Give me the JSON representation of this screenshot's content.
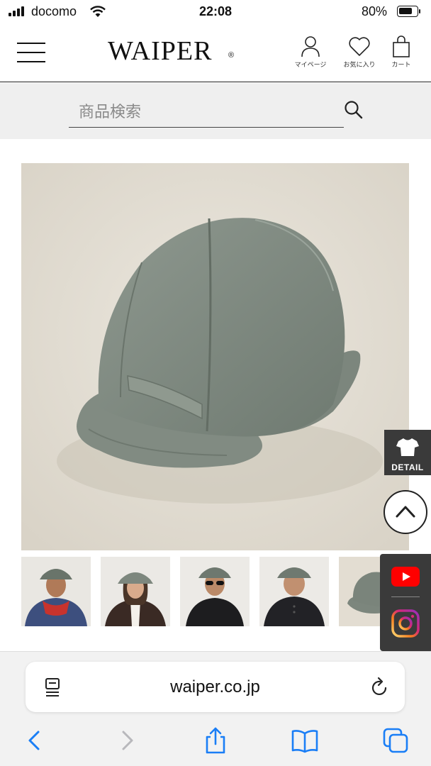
{
  "status_bar": {
    "carrier": "docomo",
    "time": "22:08",
    "battery_percent_label": "80%",
    "battery_level": 0.8,
    "signal_icon": "signal-bars-icon",
    "wifi_icon": "wifi-icon"
  },
  "header": {
    "logo_text": "WAIPER",
    "logo_mark": "®",
    "menu_icon": "hamburger-menu-icon",
    "mypage_label": "マイページ",
    "favorites_label": "お気に入り",
    "cart_label": "カート"
  },
  "search": {
    "placeholder": "商品検索",
    "icon": "search-icon"
  },
  "product": {
    "main_image": "fleece-cap-photo",
    "thumbnails": [
      "model-red-hoodie",
      "model-woman-coat",
      "model-sunglasses",
      "model-black-henley",
      "cap-detail"
    ]
  },
  "floating": {
    "detail_label": "DETAIL",
    "detail_icon": "tshirt-icon",
    "scroll_top_icon": "chevron-up-icon",
    "youtube_icon": "youtube-icon",
    "instagram_icon": "instagram-icon"
  },
  "browser": {
    "url": "waiper.co.jp",
    "reader_icon": "page-menu-icon",
    "reload_icon": "reload-icon",
    "toolbar": [
      "back-icon",
      "forward-icon",
      "share-icon",
      "bookmarks-icon",
      "tabs-icon"
    ]
  },
  "colors": {
    "accent_dark": "#3a3a3a",
    "search_band": "#efefef",
    "link_blue": "#1a7ef6",
    "youtube_red": "#ff0000"
  }
}
